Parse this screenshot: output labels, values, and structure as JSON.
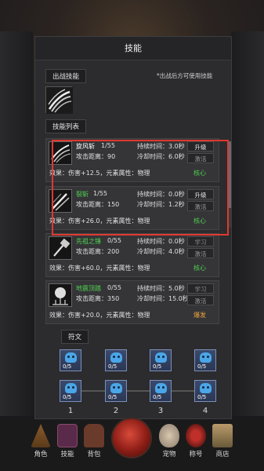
{
  "modal": {
    "title": "技能",
    "equipped_label": "出战技能",
    "hint": "*出战后方可使用技能",
    "list_label": "技能列表",
    "rune_label": "符文"
  },
  "skills": [
    {
      "name": "旋风斩",
      "name_color": "#ffffff",
      "level": "1/55",
      "range": "攻击距离：90",
      "duration": "持续时间：3.0秒",
      "cooldown": "冷却时间：6.0秒",
      "btn1": "升级",
      "btn2": "激活",
      "effect": "效果：伤害+12.5，元素属性：物理",
      "core": "核心",
      "core_color": "#4fd14f"
    },
    {
      "name": "裂斩",
      "name_color": "#4fd14f",
      "level": "1/55",
      "range": "攻击距离：150",
      "duration": "持续时间：0.0秒",
      "cooldown": "冷却时间：1.2秒",
      "btn1": "升级",
      "btn2": "激活",
      "effect": "效果：伤害+26.0，元素属性：物理",
      "core": "核心",
      "core_color": "#4fd14f"
    },
    {
      "name": "先祖之锤",
      "name_color": "#4fd14f",
      "level": "0/55",
      "range": "攻击距离：200",
      "duration": "持续时间：0.0秒",
      "cooldown": "冷却时间：4.0秒",
      "btn1": "学习",
      "btn2": "激活",
      "effect": "效果：伤害+60.0，元素属性：物理",
      "core": "核心",
      "core_color": "#4fd14f"
    },
    {
      "name": "地震顶踏",
      "name_color": "#4fd14f",
      "level": "0/55",
      "range": "攻击距离：350",
      "duration": "持续时间：5.0秒",
      "cooldown": "冷却时间：15.0秒",
      "btn1": "学习",
      "btn2": "激活",
      "effect": "效果：伤害+20.0，元素属性：物理",
      "core": "爆发",
      "core_color": "#e9a23b"
    }
  ],
  "runes": {
    "slot_count": "0/5",
    "numbers": [
      "1",
      "2",
      "3",
      "4"
    ]
  },
  "nav": [
    {
      "label": "角色",
      "icon": "tent-icon"
    },
    {
      "label": "技能",
      "icon": "skill-book-icon"
    },
    {
      "label": "背包",
      "icon": "backpack-icon"
    },
    {
      "label": "宠物",
      "icon": "egg-icon"
    },
    {
      "label": "称号",
      "icon": "gear-badge-icon"
    },
    {
      "label": "商店",
      "icon": "shop-icon"
    }
  ]
}
